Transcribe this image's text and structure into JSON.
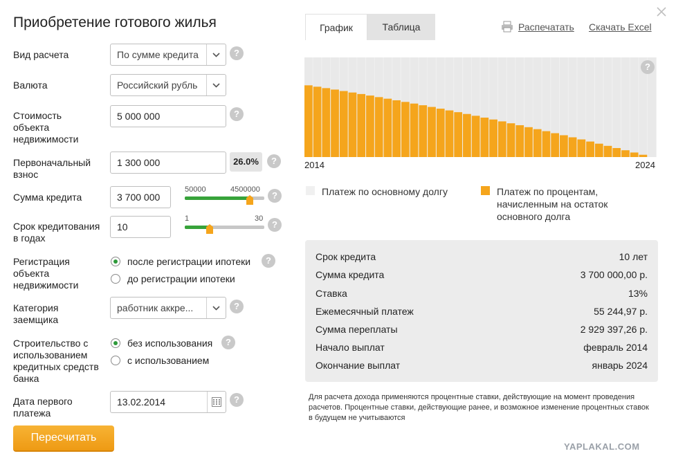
{
  "title": "Приобретение готового жилья",
  "form": {
    "calc_type": {
      "label": "Вид расчета",
      "value": "По сумме кредита"
    },
    "currency": {
      "label": "Валюта",
      "value": "Российский рубль"
    },
    "cost": {
      "label_lines": [
        "Стоимость",
        "объекта",
        "недвижимости"
      ],
      "value": "5 000 000"
    },
    "down_payment": {
      "label_lines": [
        "Первоначальный",
        "взнос"
      ],
      "value": "1 300 000",
      "percent": "26.0%"
    },
    "loan_amount": {
      "label": "Сумма кредита",
      "value": "3 700 000",
      "min_label": "50000",
      "max_label": "4500000",
      "slider_fraction": 0.82
    },
    "term": {
      "label_lines": [
        "Срок кредитования",
        "в годах"
      ],
      "value": "10",
      "min_label": "1",
      "max_label": "30",
      "slider_fraction": 0.31
    },
    "registration": {
      "label_lines": [
        "Регистрация",
        "объекта",
        "недвижимости"
      ],
      "options": [
        "после регистрации ипотеки",
        "до регистрации ипотеки"
      ],
      "selected": 0
    },
    "category": {
      "label_lines": [
        "Категория",
        "заемщика"
      ],
      "value": "работник аккре..."
    },
    "construction": {
      "label_lines": [
        "Строительство с",
        "использованием",
        "кредитных средств",
        "банка"
      ],
      "options": [
        "без использования",
        "с использованием"
      ],
      "selected": 0
    },
    "first_payment_date": {
      "label_lines": [
        "Дата первого",
        "платежа"
      ],
      "value": "13.02.2014"
    },
    "recalc_button": "Пересчитать"
  },
  "tabs": [
    "График",
    "Таблица"
  ],
  "active_tab": 0,
  "links": {
    "print": "Распечатать",
    "excel": "Скачать Excel"
  },
  "chart_data": {
    "type": "bar",
    "x_start_label": "2014",
    "x_end_label": "2024",
    "bars": 40,
    "series": [
      {
        "name": "Платеж по основному долгу",
        "color": "#f0f0f0"
      },
      {
        "name": "Платеж по процентам, начисленным на остаток основного долга",
        "color": "#f5a51c"
      }
    ],
    "interest_fraction_start": 0.72,
    "interest_fraction_end": 0.0
  },
  "legend": {
    "principal": [
      "Платеж по основному долгу"
    ],
    "interest": [
      "Платеж по процентам,",
      "начисленным на остаток",
      "основного долга"
    ]
  },
  "summary": [
    {
      "key": "Срок кредита",
      "value": "10 лет"
    },
    {
      "key": "Сумма кредита",
      "value": "3 700 000,00 р."
    },
    {
      "key": "Ставка",
      "value": "13%"
    },
    {
      "key": "Ежемесячный платеж",
      "value": "55 244,97 р."
    },
    {
      "key": "Сумма переплаты",
      "value": "2 929 397,26 р."
    },
    {
      "key": "Начало выплат",
      "value": "февраль 2014"
    },
    {
      "key": "Окончание выплат",
      "value": "январь 2024"
    }
  ],
  "note_lines": [
    "Для расчета дохода применяются процентные ставки, действующие на момент проведения",
    "расчетов. Процентные ставки, действующие ранее, и возможное изменение процентных ставок",
    "в будущем не учитываются"
  ],
  "watermark": "YAPLAKAL.COM",
  "help_glyph": "?",
  "colors": {
    "accent_orange": "#f5a51c",
    "accent_green": "#37a33a",
    "button_orange": "#f0a020"
  }
}
